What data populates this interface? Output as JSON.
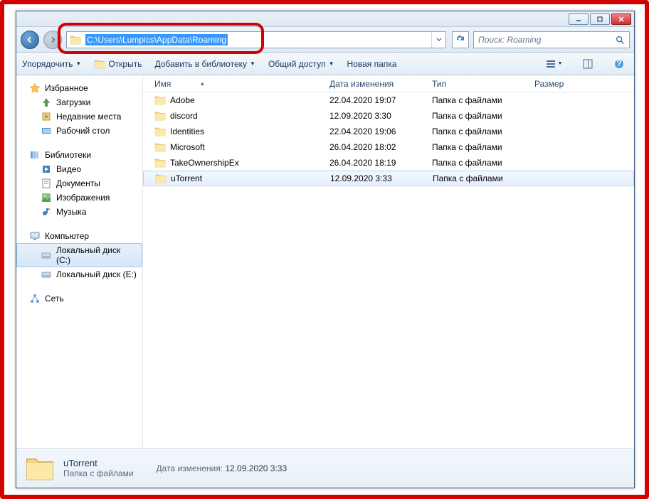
{
  "address": {
    "path": "C:\\Users\\Lumpics\\AppData\\Roaming"
  },
  "search": {
    "placeholder": "Поиск: Roaming"
  },
  "toolbar": {
    "organize": "Упорядочить",
    "open": "Открыть",
    "add_to_library": "Добавить в библиотеку",
    "share": "Общий доступ",
    "new_folder": "Новая папка"
  },
  "sidebar": {
    "favorites": {
      "label": "Избранное",
      "items": [
        "Загрузки",
        "Недавние места",
        "Рабочий стол"
      ]
    },
    "libraries": {
      "label": "Библиотеки",
      "items": [
        "Видео",
        "Документы",
        "Изображения",
        "Музыка"
      ]
    },
    "computer": {
      "label": "Компьютер",
      "items": [
        "Локальный диск (C:)",
        "Локальный диск (E:)"
      ],
      "selected_index": 0
    },
    "network": {
      "label": "Сеть"
    }
  },
  "columns": {
    "name": "Имя",
    "date": "Дата изменения",
    "type": "Тип",
    "size": "Размер"
  },
  "files": [
    {
      "name": "Adobe",
      "date": "22.04.2020 19:07",
      "type": "Папка с файлами"
    },
    {
      "name": "discord",
      "date": "12.09.2020 3:30",
      "type": "Папка с файлами"
    },
    {
      "name": "Identities",
      "date": "22.04.2020 19:06",
      "type": "Папка с файлами"
    },
    {
      "name": "Microsoft",
      "date": "26.04.2020 18:02",
      "type": "Папка с файлами"
    },
    {
      "name": "TakeOwnershipEx",
      "date": "26.04.2020 18:19",
      "type": "Папка с файлами"
    },
    {
      "name": "uTorrent",
      "date": "12.09.2020 3:33",
      "type": "Папка с файлами"
    }
  ],
  "selected_file_index": 5,
  "details": {
    "name": "uTorrent",
    "type": "Папка с файлами",
    "date_label": "Дата изменения:",
    "date_value": "12.09.2020 3:33"
  }
}
